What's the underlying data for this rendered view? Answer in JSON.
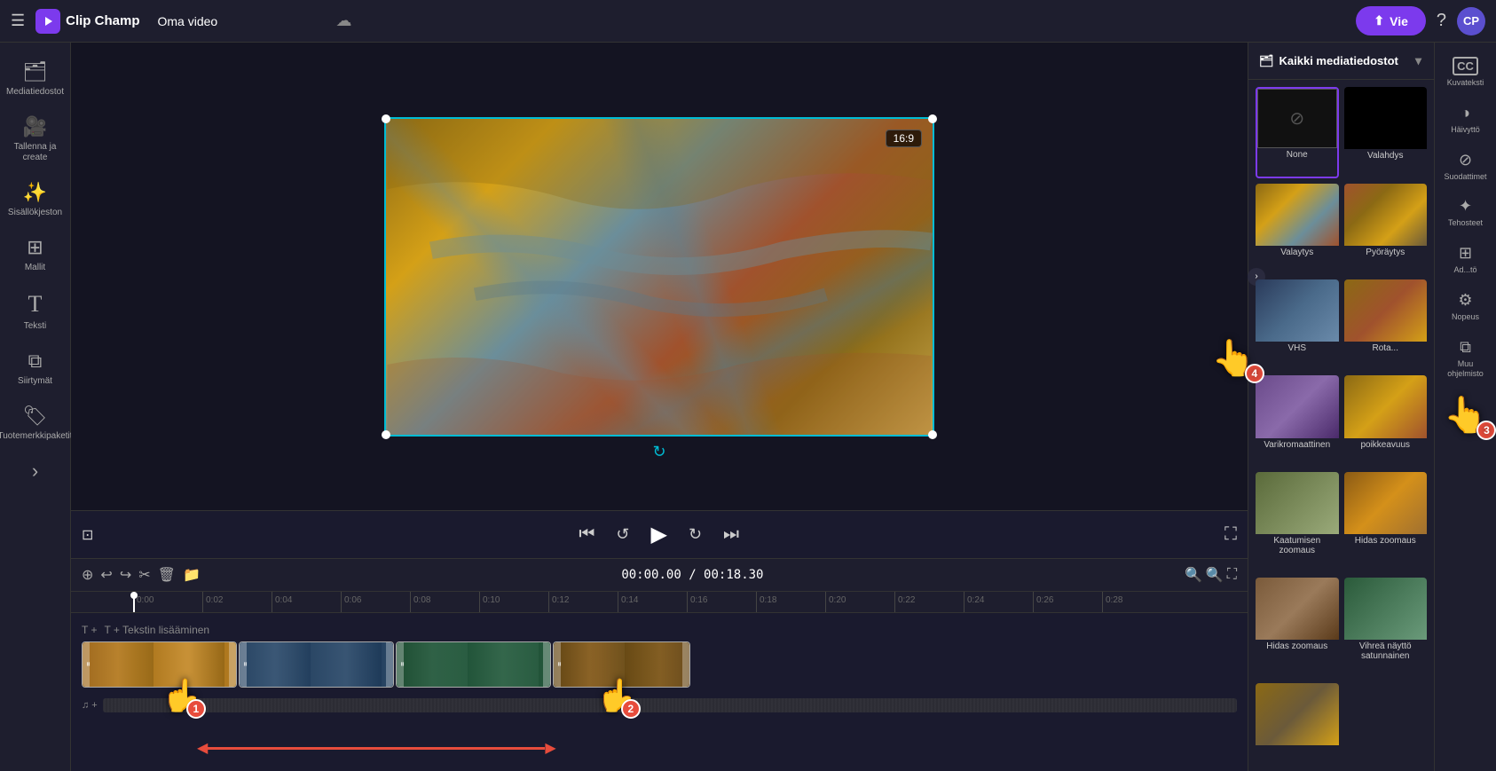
{
  "app": {
    "name": "Clip Champ",
    "logo_icon": "▶",
    "project_title": "Oma video",
    "export_label": "Vie",
    "help_icon": "?",
    "avatar_initials": "CP"
  },
  "sidebar": {
    "items": [
      {
        "id": "mediatiedostot",
        "icon": "🗂",
        "label": "Mediatiedostot"
      },
      {
        "id": "tallenna",
        "icon": "🎥",
        "label": "Tallenna ja create"
      },
      {
        "id": "sisallokjeston",
        "icon": "✨",
        "label": "Sisällökjeston"
      },
      {
        "id": "mallit",
        "icon": "⊞",
        "label": "Mallit"
      },
      {
        "id": "teksti",
        "icon": "T",
        "label": "Teksti"
      },
      {
        "id": "siirtymät",
        "icon": "⧉",
        "label": "Siirtymät"
      },
      {
        "id": "tuotemerkkipaketit",
        "icon": "🏷",
        "label": "Tuotemerkkipaketit"
      },
      {
        "id": "more",
        "icon": "›",
        "label": ""
      }
    ]
  },
  "video": {
    "aspect_ratio": "16:9",
    "current_time": "00:00.00",
    "total_time": "00:18.30"
  },
  "playback": {
    "rewind_icon": "⏮",
    "back5_icon": "↺",
    "play_icon": "▶",
    "fwd5_icon": "↻",
    "skip_icon": "⏭",
    "caption_icon": "⊡",
    "fullscreen_icon": "⛶"
  },
  "timeline": {
    "toolbar": {
      "snap_icon": "⊕",
      "undo_icon": "↩",
      "redo_icon": "↪",
      "cut_icon": "✂",
      "delete_icon": "🗑",
      "media_icon": "📁",
      "current_time": "00:00.00",
      "total_time": "00:18.30",
      "zoom_out_icon": "🔍-",
      "zoom_in_icon": "🔍+",
      "fullscreen_icon": "⛶"
    },
    "ruler_marks": [
      "0:00",
      "0:02",
      "0:04",
      "0:06",
      "0:08",
      "0:10",
      "0:12",
      "0:14",
      "0:16",
      "0:18",
      "0:20",
      "0:22",
      "0:24",
      "0:26",
      "0:28"
    ],
    "track_label": "T + Tekstin lisääminen",
    "clips": [
      {
        "id": "clip1",
        "type": "aerial_warm"
      },
      {
        "id": "clip2",
        "type": "aerial_dark"
      },
      {
        "id": "clip3",
        "type": "forest"
      },
      {
        "id": "clip4",
        "type": "aerial_warm2"
      }
    ]
  },
  "right_panel": {
    "header": "Kaikki mediatiedostot",
    "header_icon": "🗂",
    "collapse_icon": "▼",
    "media_items": [
      {
        "id": "none",
        "label": "None",
        "type": "none",
        "selected": true
      },
      {
        "id": "valahdys",
        "label": "Valahdys",
        "type": "flash"
      },
      {
        "id": "valaitys",
        "label": "Valaytys",
        "type": "aerial1"
      },
      {
        "id": "pyoraytys",
        "label": "Pyöräytys",
        "type": "aerial2"
      },
      {
        "id": "vhs",
        "label": "VHS",
        "type": "vhs"
      },
      {
        "id": "rotation",
        "label": "Rota...",
        "type": "rotation"
      },
      {
        "id": "varik",
        "label": "Varikromaattinen",
        "type": "varik"
      },
      {
        "id": "poik",
        "label": "poikkeavuus",
        "type": "poik"
      },
      {
        "id": "kaatuminen",
        "label": "Kaatumisen zoomaus",
        "type": "kaatuminen"
      },
      {
        "id": "hidas_zoomaus",
        "label": "Hidas zoomaus",
        "type": "hidas1"
      },
      {
        "id": "hidas_zoomaus2",
        "label": "Hidas zoomaus",
        "type": "hidas2"
      },
      {
        "id": "vihrea",
        "label": "Vihreä näyttö satunnainen",
        "type": "vihrea"
      },
      {
        "id": "bottom",
        "label": "",
        "type": "bottom"
      }
    ]
  },
  "right_icons": [
    {
      "id": "kuvateksti",
      "icon": "CC",
      "label": "Kuvateksti"
    },
    {
      "id": "haivytto",
      "icon": "◑",
      "label": "Häivyttö"
    },
    {
      "id": "suodattimet",
      "icon": "⊘",
      "label": "Suodattimet"
    },
    {
      "id": "tehosteet",
      "icon": "✦",
      "label": "Tehosteet"
    },
    {
      "id": "adjust",
      "icon": "⊞",
      "label": "Ad...tö"
    },
    {
      "id": "nopeus",
      "icon": "⚙",
      "label": "Nopeus"
    },
    {
      "id": "muu",
      "icon": "⧉",
      "label": "Muu ohjelmisto"
    }
  ],
  "annotations": {
    "cursor1": {
      "number": "1",
      "position": "timeline-left"
    },
    "cursor2": {
      "number": "2",
      "position": "timeline-right"
    },
    "cursor3": {
      "number": "3",
      "position": "right-panel-top"
    },
    "cursor4": {
      "number": "4",
      "position": "right-panel-bottom"
    },
    "arrow": {
      "direction": "bidirectional",
      "label": "drag range"
    }
  }
}
